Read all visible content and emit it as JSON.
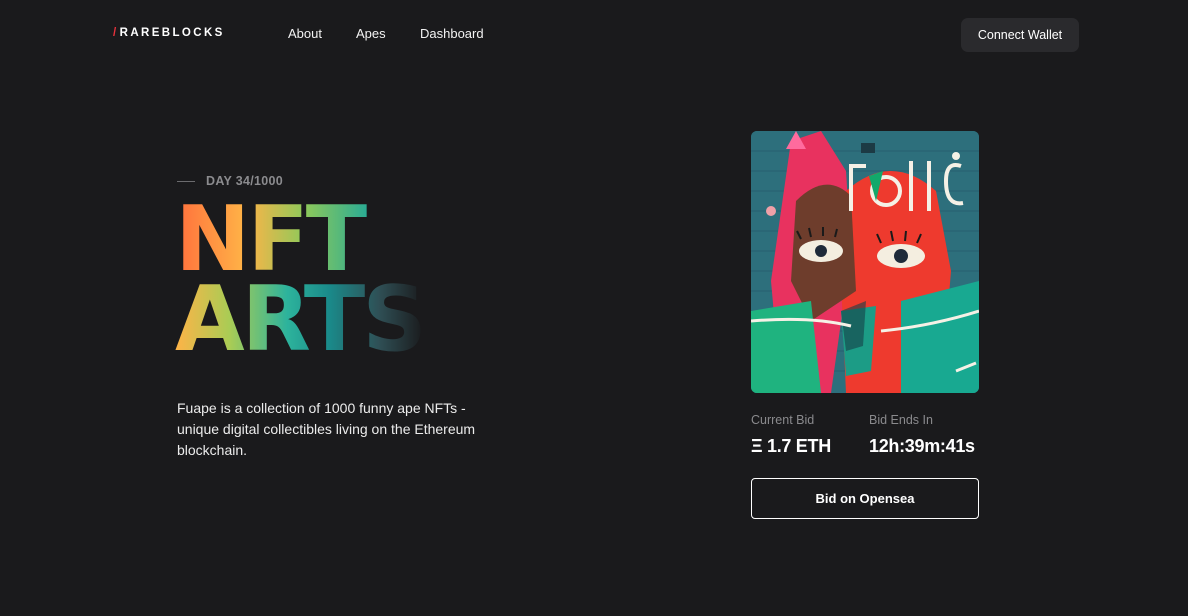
{
  "brand": {
    "slash": "/",
    "name": "RAREBLOCKS"
  },
  "nav": {
    "items": [
      "About",
      "Apes",
      "Dashboard"
    ],
    "cta_label": "Connect Wallet"
  },
  "hero": {
    "day": "DAY 34/1000",
    "title_line1": "NFT",
    "title_line2": "ARTS",
    "description": "Fuape is a collection of 1000 funny ape NFTs - unique digital collectibles living on the Ethereum blockchain."
  },
  "auction": {
    "current_bid_label": "Current Bid",
    "current_bid_value": "Ξ 1.7 ETH",
    "bid_ends_label": "Bid Ends In",
    "bid_ends_value": "12h:39m:41s",
    "button_label": "Bid on Opensea"
  },
  "colors": {
    "background": "#1a1a1c",
    "accent": "#e8323c",
    "button_dark": "#2a2a2d",
    "muted_text": "#8a8a8d"
  },
  "icons": {
    "artwork": "street-art-image"
  }
}
